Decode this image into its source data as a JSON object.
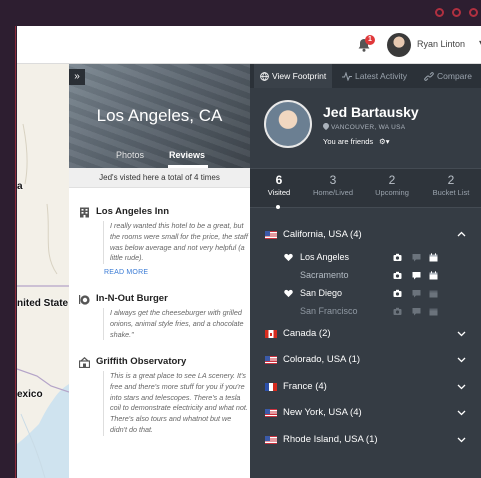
{
  "app": {
    "notification_count": "1",
    "user_name": "Ryan Linton",
    "user_caret": "▾"
  },
  "map": {
    "labels": [
      "a",
      "nited State",
      "exico"
    ],
    "colors": {
      "water": "#cfe3ef",
      "land": "#f3f0e8",
      "border": "#b4a4c8"
    }
  },
  "place": {
    "title": "Los Angeles, CA",
    "tabs": [
      "Photos",
      "Reviews"
    ],
    "active_tab": "Reviews",
    "collapse_icon": "double-chevron-right-icon",
    "visits_banner": "Jed's visted here a total of 4 times",
    "reviews": [
      {
        "icon": "hotel-icon",
        "title": "Los Angeles Inn",
        "text": "I really wanted this hotel to be a great, but the rooms were small for the price, the staff was below average and not very helpful (a little rude).",
        "read_more": "READ MORE"
      },
      {
        "icon": "restaurant-icon",
        "title": "In-N-Out Burger",
        "text": "I always get the cheeseburger with grilled onions, animal style fries, and a chocolate shake.\""
      },
      {
        "icon": "attraction-icon",
        "title": "Griffith Observatory",
        "text": "This is a great place to see LA scenery. It's free and there's more stuff for you if you're into stars and telescopes. There's a tesla coil to demonstrate electricity and what not. There's also tours and whatnot but we didn't do that."
      }
    ]
  },
  "profile": {
    "tabs": [
      {
        "label": "View Footprint",
        "icon": "globe-icon",
        "active": true
      },
      {
        "label": "Latest Activity",
        "icon": "activity-icon",
        "active": false
      },
      {
        "label": "Compare",
        "icon": "link-icon",
        "active": false
      }
    ],
    "name": "Jed Bartausky",
    "location": "VANCOUVER, WA USA",
    "friend_status": "You are friends",
    "stats": [
      {
        "value": "6",
        "label": "Visited",
        "active": true
      },
      {
        "value": "3",
        "label": "Home/Lived",
        "active": false
      },
      {
        "value": "2",
        "label": "Upcoming",
        "active": false
      },
      {
        "value": "2",
        "label": "Bucket List",
        "active": false
      }
    ],
    "regions": [
      {
        "flag": "us",
        "name": "California, USA (4)",
        "expanded": true,
        "cities": [
          {
            "name": "Los Angeles",
            "favorite": true,
            "style": "visited",
            "icons": [
              "camera-icon",
              "comment-icon",
              "calendar-icon"
            ],
            "icon_state": [
              "on",
              "dim",
              "on"
            ]
          },
          {
            "name": "Sacramento",
            "favorite": false,
            "style": "plain",
            "icons": [
              "camera-icon",
              "comment-icon",
              "calendar-icon"
            ],
            "icon_state": [
              "on",
              "on",
              "on"
            ]
          },
          {
            "name": "San Diego",
            "favorite": true,
            "style": "visited",
            "icons": [
              "camera-icon",
              "comment-icon",
              "calendar-icon"
            ],
            "icon_state": [
              "on",
              "dim",
              "dim"
            ]
          },
          {
            "name": "San Francisco",
            "favorite": false,
            "style": "dim",
            "icons": [
              "camera-icon",
              "comment-icon",
              "calendar-icon"
            ],
            "icon_state": [
              "dim",
              "dim",
              "dim"
            ]
          }
        ]
      },
      {
        "flag": "ca",
        "name": "Canada (2)",
        "expanded": false
      },
      {
        "flag": "us",
        "name": "Colorado, USA (1)",
        "expanded": false
      },
      {
        "flag": "fr",
        "name": "France (4)",
        "expanded": false
      },
      {
        "flag": "us",
        "name": "New York, USA (4)",
        "expanded": false
      },
      {
        "flag": "us",
        "name": "Rhode Island, USA (1)",
        "expanded": false
      }
    ]
  },
  "colors": {
    "panel_dark": "#353c44",
    "accent_link": "#3a7bd5",
    "badge_red": "#e0383a"
  }
}
